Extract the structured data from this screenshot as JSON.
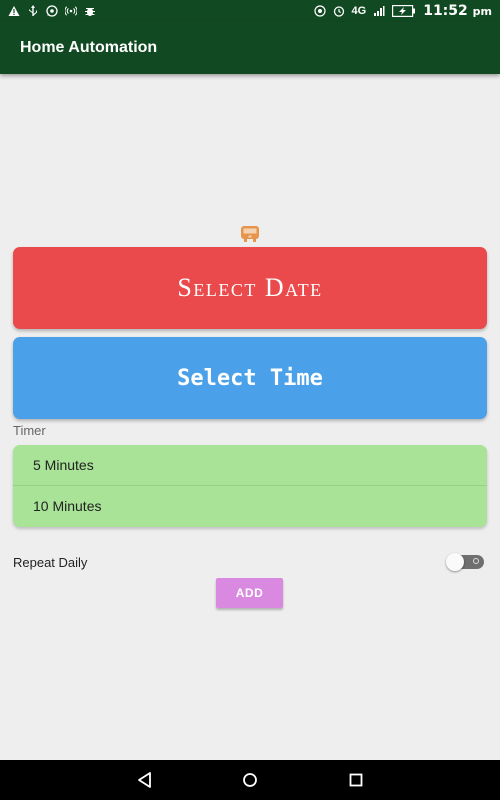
{
  "status_bar": {
    "time": "11:52",
    "time_suffix": "pm",
    "network": "4G",
    "left_icons": [
      "warning-icon",
      "usb-icon",
      "whatsapp-icon",
      "hotspot-icon",
      "bug-icon"
    ],
    "right_icons": [
      "wifi-hotspot-icon",
      "alarm-icon",
      "signal-icon",
      "battery-charging-icon"
    ]
  },
  "app_bar": {
    "title": "Home Automation"
  },
  "device_icon": "bus-icon",
  "buttons": {
    "select_date": "Select Date",
    "select_time": "Select Time",
    "add": "ADD"
  },
  "timer": {
    "label": "Timer",
    "options": [
      "5 Minutes",
      "10 Minutes"
    ]
  },
  "repeat": {
    "label": "Repeat Daily",
    "enabled": false
  },
  "nav_bar": {
    "icons": [
      "back-icon",
      "home-icon",
      "recents-icon"
    ]
  },
  "colors": {
    "primary_dark": "#114a22",
    "date_button": "#ea4a4c",
    "time_button": "#4aa0e9",
    "timer_list": "#a8e397",
    "add_button": "#d98ae0",
    "device_icon": "#e6954d",
    "background": "#eeeeee"
  }
}
